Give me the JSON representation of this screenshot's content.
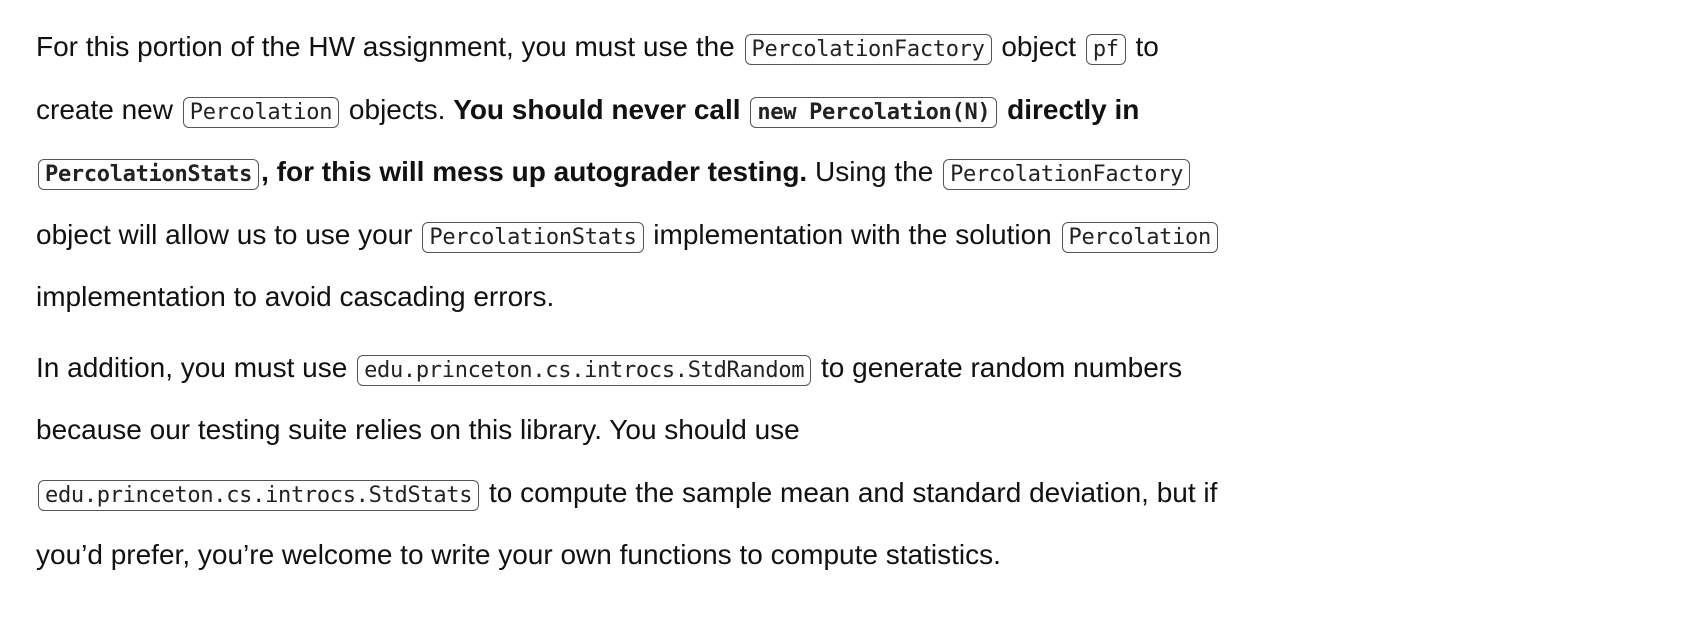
{
  "paragraphs": [
    {
      "lines": [
        [
          {
            "t": "text",
            "v": "For this portion of the HW assignment, you must use the "
          },
          {
            "t": "code",
            "v": "PercolationFactory"
          },
          {
            "t": "text",
            "v": " object "
          },
          {
            "t": "code",
            "v": "pf"
          },
          {
            "t": "text",
            "v": " to"
          }
        ],
        [
          {
            "t": "text",
            "v": "create new "
          },
          {
            "t": "code",
            "v": "Percolation"
          },
          {
            "t": "text",
            "v": " objects. "
          },
          {
            "t": "bold",
            "v": "You should never call "
          },
          {
            "t": "boldcode",
            "v": "new Percolation(N)"
          },
          {
            "t": "bold",
            "v": " directly in"
          }
        ],
        [
          {
            "t": "boldcode",
            "v": "PercolationStats"
          },
          {
            "t": "bold",
            "v": ", for this will mess up autograder testing."
          },
          {
            "t": "text",
            "v": " Using the "
          },
          {
            "t": "code",
            "v": "PercolationFactory"
          }
        ],
        [
          {
            "t": "text",
            "v": "object will allow us to use your "
          },
          {
            "t": "code",
            "v": "PercolationStats"
          },
          {
            "t": "text",
            "v": " implementation with the solution "
          },
          {
            "t": "code",
            "v": "Percolation"
          }
        ],
        [
          {
            "t": "text",
            "v": "implementation to avoid cascading errors."
          }
        ]
      ]
    },
    {
      "lines": [
        [
          {
            "t": "text",
            "v": "In addition, you must use "
          },
          {
            "t": "code",
            "v": "edu.princeton.cs.introcs.StdRandom"
          },
          {
            "t": "text",
            "v": " to generate random numbers"
          }
        ],
        [
          {
            "t": "text",
            "v": "because our testing suite relies on this library. You should use"
          }
        ],
        [
          {
            "t": "code",
            "v": "edu.princeton.cs.introcs.StdStats"
          },
          {
            "t": "text",
            "v": " to compute the sample mean and standard deviation, but if"
          }
        ],
        [
          {
            "t": "text",
            "v": "you’d prefer, you’re welcome to write your own functions to compute statistics."
          }
        ]
      ]
    }
  ]
}
